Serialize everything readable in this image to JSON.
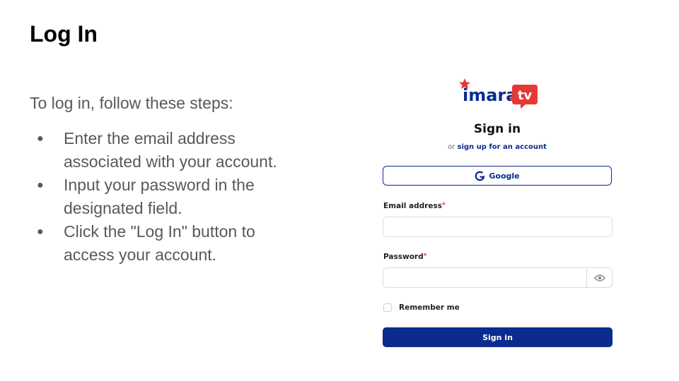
{
  "slide": {
    "title": "Log In",
    "intro": "To log in, follow these steps:",
    "steps": [
      "Enter the email address associated with your account.",
      "Input your password in the designated field.",
      "Click the \"Log In\" button to access your account."
    ],
    "bullet": "●"
  },
  "signin": {
    "logo_text": "imara.tv",
    "logo_imara": "imara",
    "logo_tv": "tv",
    "title": "Sign in",
    "or_text": "or",
    "signup_link": "sign up for an account",
    "google_label": "Google",
    "email_label": "Email address",
    "password_label": "Password",
    "required_mark": "*",
    "remember_label": "Remember me",
    "submit_label": "Sign in",
    "brand_color": "#0b2b8f",
    "logo_red": "#e53935"
  }
}
